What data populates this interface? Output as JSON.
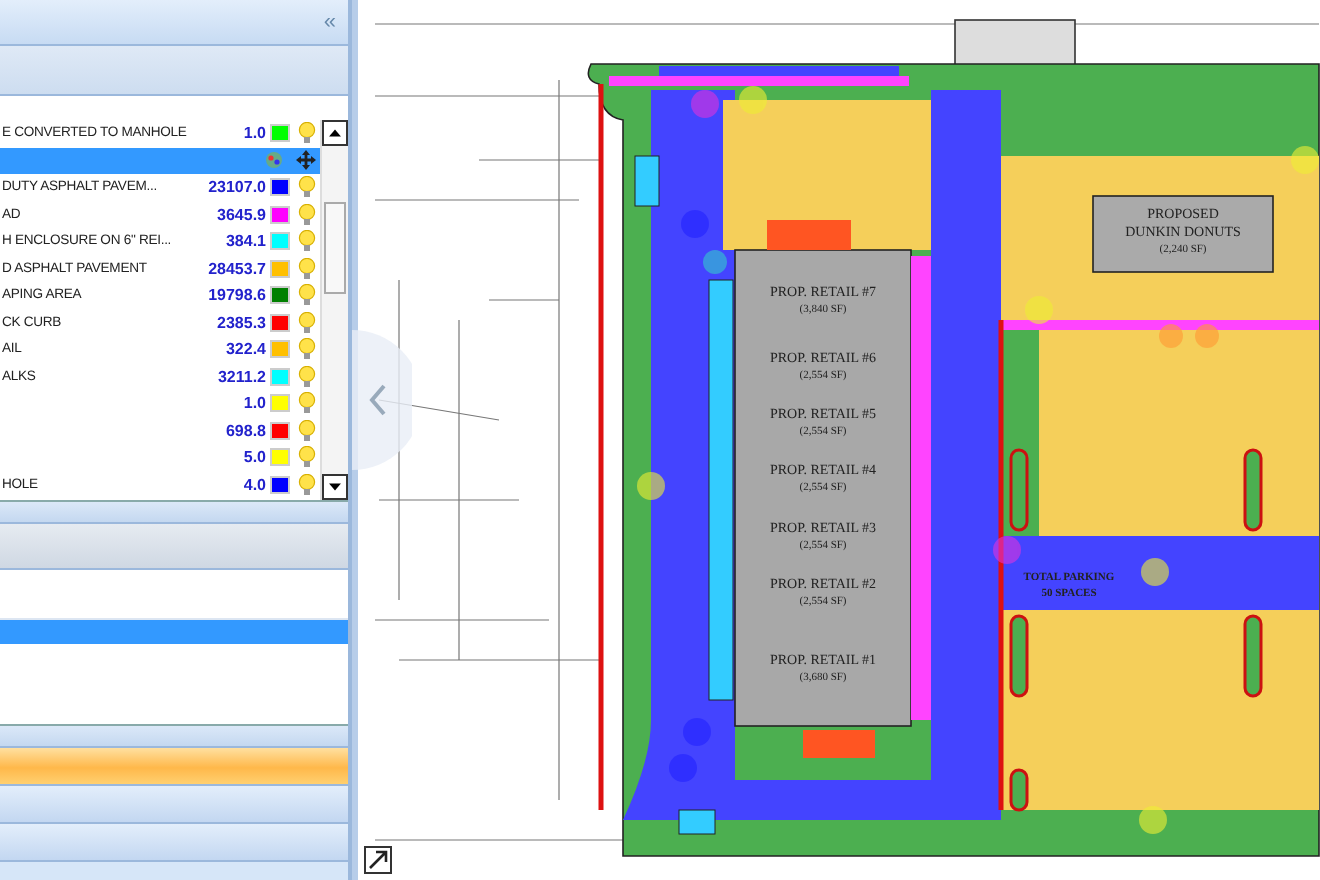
{
  "panel": {
    "collapse_glyph": "«",
    "layers": [
      {
        "name": "E CONVERTED TO MANHOLE",
        "value": "1.0",
        "color": "#00ff00",
        "selected": false
      },
      {
        "selected": true
      },
      {
        "name": "DUTY ASPHALT PAVEM...",
        "value": "23107.0",
        "color": "#0000ff",
        "selected": false
      },
      {
        "name": "AD",
        "value": "3645.9",
        "color": "#ff00ff",
        "selected": false
      },
      {
        "name": "H ENCLOSURE ON 6\" REI...",
        "value": "384.1",
        "color": "#00ffff",
        "selected": false
      },
      {
        "name": "D ASPHALT PAVEMENT",
        "value": "28453.7",
        "color": "#ffc000",
        "selected": false
      },
      {
        "name": "APING AREA",
        "value": "19798.6",
        "color": "#008000",
        "selected": false
      },
      {
        "name": "CK CURB",
        "value": "2385.3",
        "color": "#ff0000",
        "selected": false
      },
      {
        "name": "AIL",
        "value": "322.4",
        "color": "#ffc000",
        "selected": false
      },
      {
        "name": "ALKS",
        "value": "3211.2",
        "color": "#00ffff",
        "selected": false
      },
      {
        "value": "1.0",
        "color": "#ffff00",
        "selected": false
      },
      {
        "value": "698.8",
        "color": "#ff0000",
        "selected": false
      },
      {
        "value": "5.0",
        "color": "#ffff00",
        "selected": false
      },
      {
        "name": "HOLE",
        "value": "4.0",
        "color": "#0000ff",
        "selected": false
      }
    ],
    "lower_list": [
      {
        "selected": false
      },
      {
        "selected": true
      }
    ],
    "nav_bars": [
      {
        "selected": true
      },
      {
        "selected": false
      },
      {
        "selected": false
      }
    ]
  },
  "plan": {
    "labels": [
      {
        "kind": "building",
        "text": "PROPOSED"
      },
      {
        "kind": "building",
        "text": "DUNKIN DONUTS"
      },
      {
        "kind": "note",
        "text": "(2,240 SF)"
      },
      {
        "kind": "building",
        "text": "PROP. RETAIL #7"
      },
      {
        "kind": "note",
        "text": "(3,840 SF)"
      },
      {
        "kind": "building",
        "text": "PROP. RETAIL #6"
      },
      {
        "kind": "note",
        "text": "(2,554 SF)"
      },
      {
        "kind": "building",
        "text": "PROP. RETAIL #5"
      },
      {
        "kind": "note",
        "text": "(2,554 SF)"
      },
      {
        "kind": "building",
        "text": "PROP. RETAIL #4"
      },
      {
        "kind": "note",
        "text": "(2,554 SF)"
      },
      {
        "kind": "building",
        "text": "PROP. RETAIL #3"
      },
      {
        "kind": "note",
        "text": "(2,554 SF)"
      },
      {
        "kind": "building",
        "text": "PROP. RETAIL #2"
      },
      {
        "kind": "note",
        "text": "(2,554 SF)"
      },
      {
        "kind": "building",
        "text": "PROP. RETAIL #1"
      },
      {
        "kind": "note",
        "text": "(3,680 SF)"
      },
      {
        "kind": "parking",
        "text": "TOTAL PARKING"
      },
      {
        "kind": "parking",
        "text": "50 SPACES"
      }
    ]
  }
}
